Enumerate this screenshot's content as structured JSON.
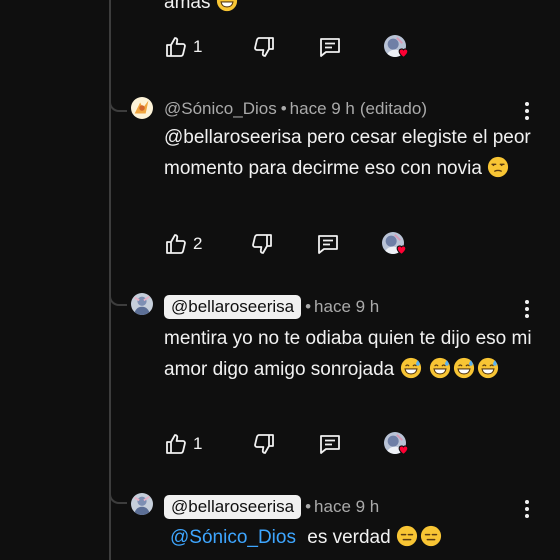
{
  "comments": [
    {
      "body_tail": "amas",
      "likes": "1"
    },
    {
      "author": "@Sónico_Dios",
      "time": "hace 9 h",
      "edited": "(editado)",
      "body": "@bellaroseerisa pero cesar elegiste el peor momento para decirme eso con novia",
      "likes": "2"
    },
    {
      "author": "@bellaroseerisa",
      "time": "hace 9 h",
      "body": "mentira yo no te odiaba quien te dijo eso mi amor digo amigo sonrojada",
      "likes": "1"
    },
    {
      "author": "@bellaroseerisa",
      "time": "hace 9 h",
      "mention": "@Sónico_Dios",
      "body": "es verdad"
    }
  ],
  "header_separator": "•",
  "icons": [
    "like-icon",
    "dislike-icon",
    "reply-icon",
    "creator-heart-icon",
    "more-options-icon"
  ],
  "colors": {
    "background": "#0f0f0f",
    "text": "#f1f1f1",
    "secondary_text": "#aaaaaa",
    "mention": "#3ea6ff",
    "heart": "#ff0033",
    "thread_line": "#3d3d3d"
  }
}
